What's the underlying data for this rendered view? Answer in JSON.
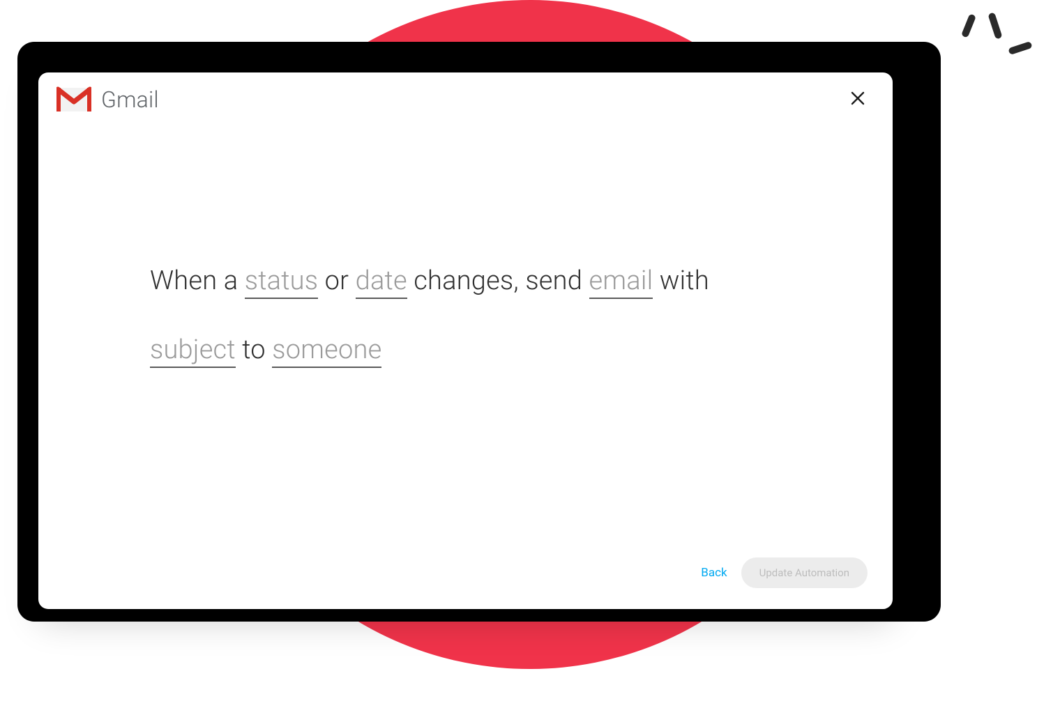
{
  "header": {
    "app_label": "Gmail"
  },
  "sentence": {
    "t0": "When a ",
    "ph_status": "status",
    "t1": " or ",
    "ph_date": "date",
    "t2": " changes,  send ",
    "ph_email": "email",
    "t3": " with ",
    "ph_subject": "subject",
    "t4": " to ",
    "ph_someone": "someone"
  },
  "footer": {
    "back_label": "Back",
    "update_label": "Update Automation"
  },
  "colors": {
    "accent_circle": "#f0334a",
    "link": "#01a9f1"
  }
}
